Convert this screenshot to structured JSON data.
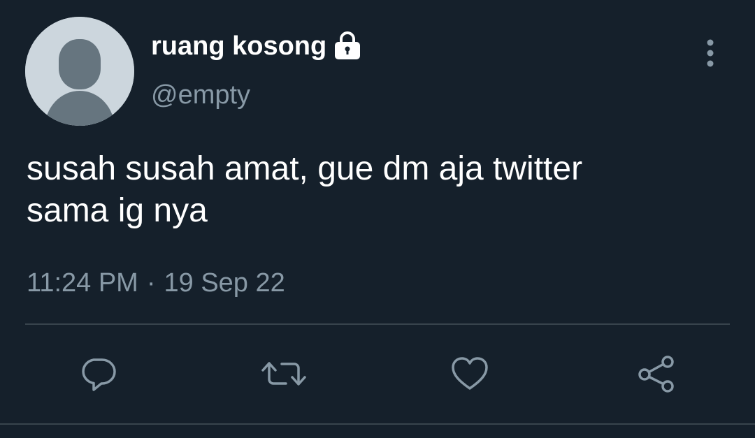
{
  "user": {
    "display_name": "ruang kosong",
    "handle": "@empty",
    "protected": true,
    "avatar": "default-profile-avatar"
  },
  "tweet": {
    "text_line1": "susah susah amat, gue dm aja twitter",
    "text_line2": "sama ig nya",
    "time": "11:24 PM",
    "separator": "·",
    "date": "19 Sep 22"
  },
  "actions": [
    {
      "name": "reply",
      "icon": "comment-icon"
    },
    {
      "name": "retweet",
      "icon": "retweet-icon"
    },
    {
      "name": "like",
      "icon": "heart-icon"
    },
    {
      "name": "share",
      "icon": "share-icon"
    }
  ],
  "colors": {
    "background": "#15202b",
    "primary_text": "#ffffff",
    "secondary_text": "#8899a6",
    "divider": "#38444d",
    "icon": "#8899a6",
    "avatar_bg": "#ccd6dd",
    "avatar_figure": "#66757f"
  }
}
